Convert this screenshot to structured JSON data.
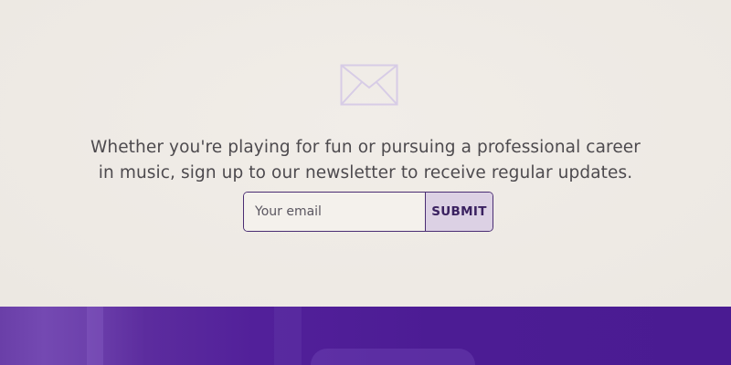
{
  "newsletter": {
    "icon": "envelope-icon",
    "message_line1": "Whether you're playing for fun or pursuing a professional career",
    "message_line2": "in music, sign up to our newsletter to receive regular updates.",
    "email_placeholder": "Your email",
    "email_value": "",
    "submit_label": "SUBMIT"
  },
  "colors": {
    "background": "#efebe6",
    "text": "#4d4a4e",
    "accent_border": "#4a2d73",
    "button_bg": "#dcd1e4",
    "button_text": "#3a2160",
    "icon_stroke": "#d7cce6",
    "footer_purple": "#4a1b92"
  }
}
